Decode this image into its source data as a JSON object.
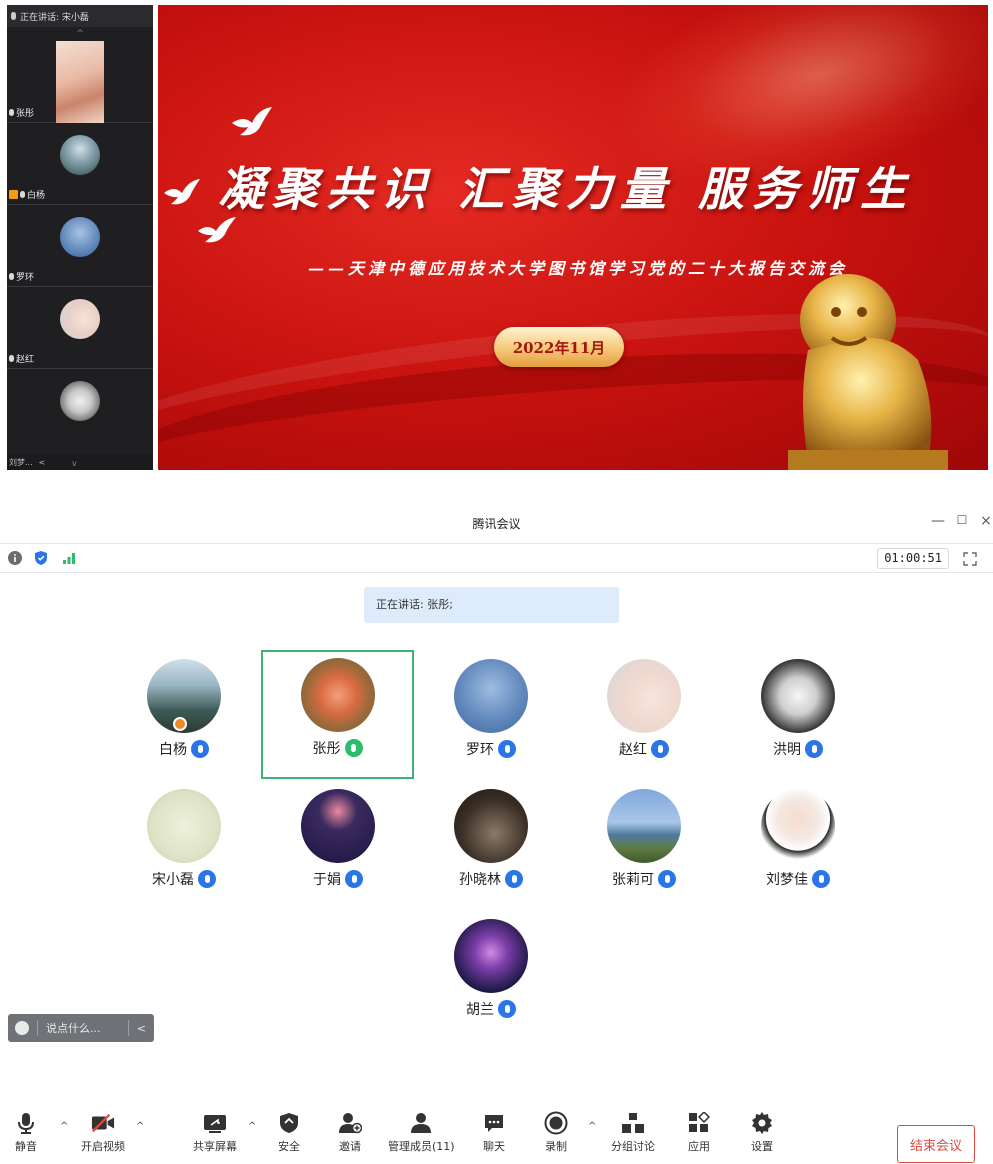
{
  "top_screenshot": {
    "sidebar": {
      "header_text": "正在讲话: 宋小磊",
      "tiles": [
        {
          "name": "张彤"
        },
        {
          "name": "白杨"
        },
        {
          "name": "罗环"
        },
        {
          "name": "赵红"
        },
        {
          "name": "刘梦..."
        }
      ],
      "up_arrow": "^",
      "down_arrow": "v",
      "collapse": "<"
    },
    "slide": {
      "title": "凝聚共识 汇聚力量 服务师生",
      "subtitle": "——天津中德应用技术大学图书馆学习党的二十大报告交流会",
      "date": "2022年11月"
    }
  },
  "window": {
    "title": "腾讯会议",
    "minimize": "—",
    "maximize": "☐",
    "close": "×"
  },
  "info_bar": {
    "timer": "01:00:51"
  },
  "speaking": {
    "text": "正在讲话: 张彤;"
  },
  "participants": [
    {
      "name": "白杨",
      "mic": "on",
      "host": true
    },
    {
      "name": "张彤",
      "mic": "speaking",
      "active": true
    },
    {
      "name": "罗环",
      "mic": "muted"
    },
    {
      "name": "赵红",
      "mic": "on"
    },
    {
      "name": "洪明",
      "mic": "muted"
    },
    {
      "name": "宋小磊",
      "mic": "muted"
    },
    {
      "name": "于娟",
      "mic": "muted"
    },
    {
      "name": "孙晓林",
      "mic": "muted"
    },
    {
      "name": "张莉可",
      "mic": "muted"
    },
    {
      "name": "刘梦佳",
      "mic": "muted"
    },
    {
      "name": "胡兰",
      "mic": "muted"
    }
  ],
  "chat": {
    "placeholder": "说点什么...",
    "collapse": "<"
  },
  "toolbar": {
    "mute": "静音",
    "video": "开启视频",
    "share": "共享屏幕",
    "security": "安全",
    "invite": "邀请",
    "members": "管理成员(11)",
    "chat": "聊天",
    "record": "录制",
    "breakout": "分组讨论",
    "apps": "应用",
    "settings": "设置",
    "end": "结束会议"
  },
  "colors": {
    "accent_blue": "#2a76e8",
    "speaking_green": "#2bbd6a",
    "end_red": "#e2483d",
    "speaking_bar": "#deebfa",
    "slide_red": "#c8120f"
  }
}
